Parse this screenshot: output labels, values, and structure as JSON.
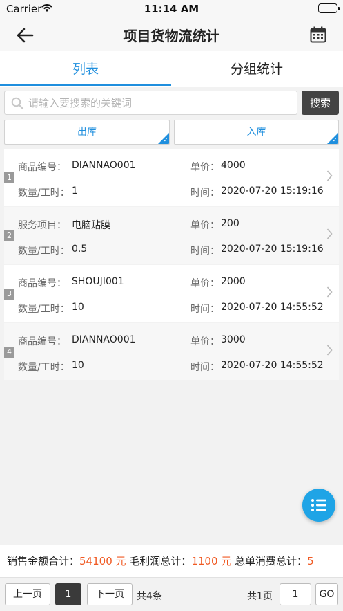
{
  "status_bar": {
    "carrier": "Carrier",
    "time": "11:14 AM"
  },
  "nav": {
    "title": "项目货物流统计"
  },
  "tabs": [
    {
      "label": "列表",
      "active": true
    },
    {
      "label": "分组统计",
      "active": false
    }
  ],
  "search": {
    "placeholder": "请输入要搜索的关键词",
    "value": "",
    "button_label": "搜索"
  },
  "filters": [
    {
      "label": "出库",
      "selected": true
    },
    {
      "label": "入库",
      "selected": true
    }
  ],
  "records": [
    {
      "index": "1",
      "code_label": "商品编号：",
      "code": "DIANNAO001",
      "price_label": "单价：",
      "price": "4000",
      "qty_label": "数量/工时：",
      "qty": "1",
      "time_label": "时间：",
      "time": "2020-07-20 15:19:16"
    },
    {
      "index": "2",
      "code_label": "服务项目：",
      "code": "电脑贴膜",
      "price_label": "单价：",
      "price": "200",
      "qty_label": "数量/工时：",
      "qty": "0.5",
      "time_label": "时间：",
      "time": "2020-07-20 15:19:16"
    },
    {
      "index": "3",
      "code_label": "商品编号：",
      "code": "SHOUJI001",
      "price_label": "单价：",
      "price": "2000",
      "qty_label": "数量/工时：",
      "qty": "10",
      "time_label": "时间：",
      "time": "2020-07-20 14:55:52"
    },
    {
      "index": "4",
      "code_label": "商品编号：",
      "code": "DIANNAO001",
      "price_label": "单价：",
      "price": "3000",
      "qty_label": "数量/工时：",
      "qty": "10",
      "time_label": "时间：",
      "time": "2020-07-20 14:55:52"
    }
  ],
  "summary": {
    "sales_label": "销售金额合计：",
    "sales_value": "54100 元",
    "profit_label": "毛利润总计：",
    "profit_value": "1100 元",
    "consume_label": "总单消费总计：",
    "consume_value": "5"
  },
  "pagination": {
    "prev_label": "上一页",
    "current_page": "1",
    "next_label": "下一页",
    "total_records": "共4条",
    "total_pages": "共1页",
    "goto_value": "1",
    "go_label": "GO"
  },
  "colors": {
    "accent": "#1f8fde",
    "amount": "#f05a23",
    "fab": "#1fa4e6"
  },
  "icons": {
    "back": "arrow-left-icon",
    "calendar": "calendar-icon",
    "search": "search-icon",
    "fab": "list-icon",
    "row": "chevron-right-icon"
  }
}
